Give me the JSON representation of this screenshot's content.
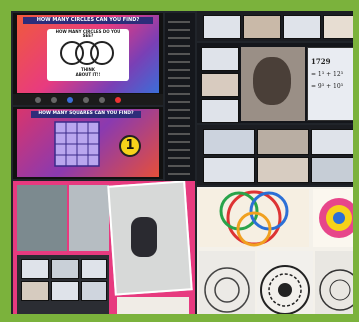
{
  "colors": {
    "frame": "#7bb23c",
    "pink": "#e73a7f",
    "yellow": "#f6d21a"
  },
  "slide1": {
    "header": "HOW MANY CIRCLES CAN YOU FIND?",
    "question": "HOW MANY CIRCLES DO YOU SEE?",
    "footer1": "THINK",
    "footer2": "ABOUT IT!!"
  },
  "slide2": {
    "header": "HOW MANY SQUARES CAN YOU FIND?",
    "badge": "1"
  },
  "math": {
    "line1": "1729",
    "line2": "= 1³ + 12³",
    "line3": "= 9³ + 10³"
  }
}
